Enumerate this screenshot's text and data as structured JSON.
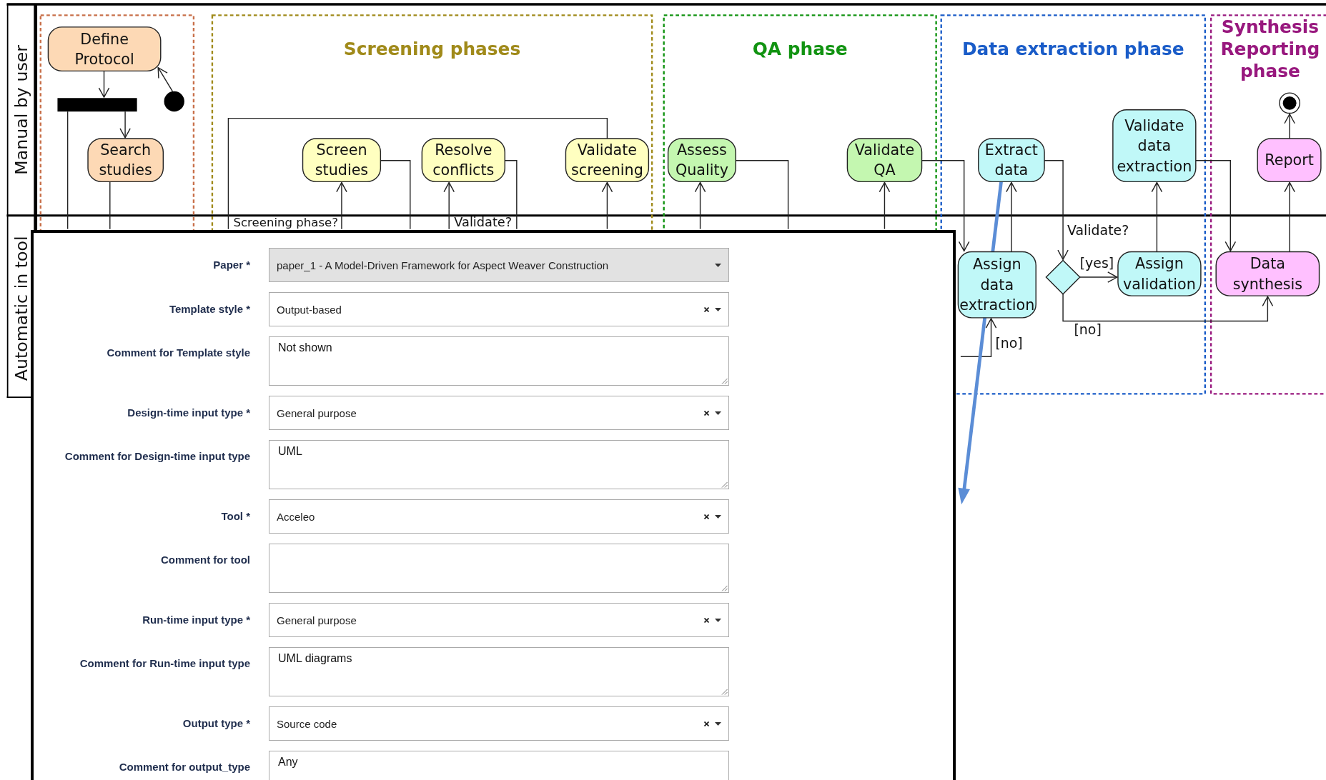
{
  "lanes": [
    {
      "label": "Manual by user"
    },
    {
      "label": "Automatic in tool"
    }
  ],
  "phases": [
    {
      "color": "#c8704a"
    },
    {
      "title_lines": [
        "Screening phases"
      ],
      "color": "#a08a1a"
    },
    {
      "title_lines": [
        "QA phase"
      ],
      "color": "#119311"
    },
    {
      "title_lines": [
        "Data extraction phase"
      ],
      "color": "#1a5cc8"
    },
    {
      "title_lines": [
        "Synthesis",
        "Reporting",
        "phase"
      ],
      "color": "#98187e"
    }
  ],
  "nodes": [
    {
      "kind": "action",
      "lines": [
        "Define",
        "Protocol"
      ],
      "color": "#fdd9b5"
    },
    {
      "kind": "initial"
    },
    {
      "kind": "fork"
    },
    {
      "kind": "action",
      "lines": [
        "Search",
        "studies"
      ],
      "color": "#fdd9b5"
    },
    {
      "kind": "action",
      "lines": [
        "Screen",
        "studies"
      ],
      "color": "#ffffc0"
    },
    {
      "kind": "action",
      "lines": [
        "Resolve",
        "conflicts"
      ],
      "color": "#ffffc0"
    },
    {
      "kind": "action",
      "lines": [
        "Validate",
        "screening"
      ],
      "color": "#ffffc0"
    },
    {
      "kind": "action",
      "lines": [
        "Assess",
        "Quality"
      ],
      "color": "#c4f7b0"
    },
    {
      "kind": "action",
      "lines": [
        "Validate",
        "QA"
      ],
      "color": "#c4f7b0"
    },
    {
      "kind": "action",
      "lines": [
        "Extract",
        "data"
      ],
      "color": "#c0f8f8"
    },
    {
      "kind": "action",
      "lines": [
        "Validate",
        "data",
        "extraction"
      ],
      "color": "#c0f8f8"
    },
    {
      "kind": "final"
    },
    {
      "kind": "action",
      "lines": [
        "Report"
      ],
      "color": "#ffc0ff"
    },
    {
      "kind": "action",
      "lines": [
        "Assign",
        "data",
        "extraction"
      ],
      "color": "#c0f8f8"
    },
    {
      "kind": "decision",
      "color": "#c0f8f8"
    },
    {
      "kind": "action",
      "lines": [
        "Assign",
        "validation"
      ],
      "color": "#c0f8f8"
    },
    {
      "kind": "action",
      "lines": [
        "Data",
        "synthesis"
      ],
      "color": "#ffc0ff"
    }
  ],
  "guards": [
    "Screening phase?",
    "Validate?",
    "Validate?",
    "[yes]",
    "[no]",
    "[no]"
  ],
  "form": {
    "fields": [
      {
        "kind": "select",
        "label": "Paper *",
        "value": "paper_1 - A Model-Driven Framework for Aspect Weaver Construction",
        "disabled": true,
        "clearable": false
      },
      {
        "kind": "select",
        "label": "Template style *",
        "value": "Output-based",
        "disabled": false,
        "clearable": true
      },
      {
        "kind": "textarea",
        "label": "Comment for Template style",
        "value": "Not shown"
      },
      {
        "kind": "select",
        "label": "Design-time input type *",
        "value": "General purpose",
        "disabled": false,
        "clearable": true
      },
      {
        "kind": "textarea",
        "label": "Comment for Design-time input type",
        "value": "UML"
      },
      {
        "kind": "select",
        "label": "Tool *",
        "value": "Acceleo",
        "disabled": false,
        "clearable": true
      },
      {
        "kind": "textarea",
        "label": "Comment for tool"
      },
      {
        "kind": "select",
        "label": "Run-time input type *",
        "value": "General purpose",
        "disabled": false,
        "clearable": true
      },
      {
        "kind": "textarea",
        "label": "Comment for Run-time input type",
        "value": "UML diagrams"
      },
      {
        "kind": "select",
        "label": "Output type *",
        "value": "Source code",
        "disabled": false,
        "clearable": true
      },
      {
        "kind": "textarea",
        "label": "Comment for output_type",
        "value": "Any"
      }
    ]
  }
}
